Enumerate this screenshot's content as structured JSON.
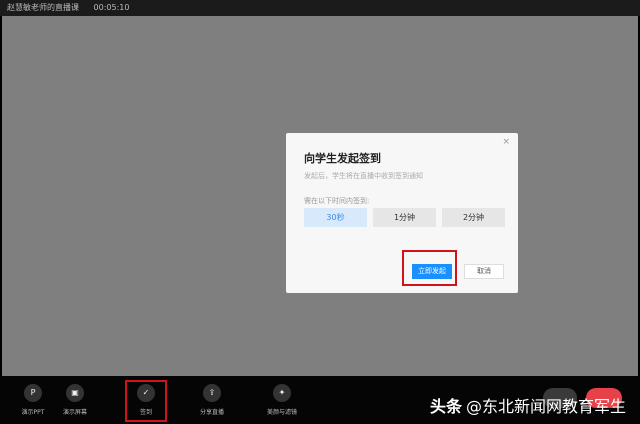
{
  "topbar": {
    "title": "赵慧敏老师的直播课",
    "timer": "00:05:10"
  },
  "dialog": {
    "title": "向学生发起签到",
    "subtitle": "发起后，学生将在直播中收到签到通知",
    "label": "需在以下时间内签到:",
    "options": [
      "30秒",
      "1分钟",
      "2分钟"
    ],
    "selected": "30秒",
    "start": "立即发起",
    "cancel": "取消",
    "close": "×"
  },
  "toolbar": {
    "items": [
      {
        "label": "演示PPT",
        "icon": "P"
      },
      {
        "label": "演示屏幕",
        "icon": "▣"
      },
      {
        "label": "签到",
        "icon": "✓"
      },
      {
        "label": "分享直播",
        "icon": "⇪"
      },
      {
        "label": "美颜与滤镜",
        "icon": "✦"
      }
    ]
  },
  "watermark": {
    "brand": "头条",
    "handle": "@东北新闻网教育军生"
  },
  "colors": {
    "accent": "#1890ff",
    "highlight": "#d0121b"
  }
}
